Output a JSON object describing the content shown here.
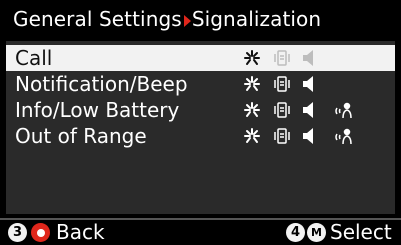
{
  "header": {
    "parent": "General Settings",
    "current": "Signalization"
  },
  "rows": [
    {
      "label": "Call"
    },
    {
      "label": "Notification/Beep"
    },
    {
      "label": "Info/Low Battery"
    },
    {
      "label": "Out of Range"
    }
  ],
  "selected_row": "Call",
  "icons": {
    "light": "light-flash-icon",
    "vibration": "vibration-icon",
    "speaker": "speaker-icon",
    "voice": "voice-announcement-icon"
  },
  "footer": {
    "left_key": "3",
    "left_label": "Back",
    "right_key": "4",
    "right_key_letter": "M",
    "right_label": "Select"
  },
  "colors": {
    "accent_red": "#e0261b",
    "panel_bg": "#2a2a2a",
    "selected_bg": "#f2f2f2"
  }
}
